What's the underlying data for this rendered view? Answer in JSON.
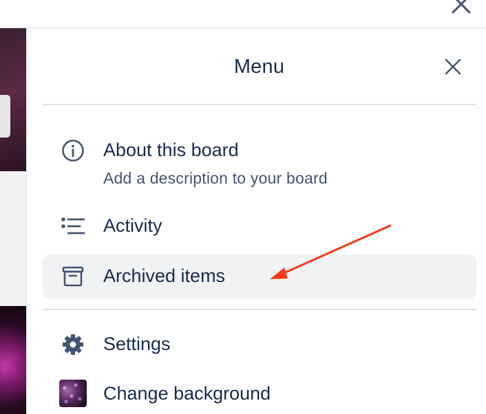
{
  "window": {
    "close_icon": "close-icon"
  },
  "menu": {
    "title": "Menu",
    "close_icon": "close-icon",
    "items": [
      {
        "label": "About this board",
        "description": "Add a description to your board",
        "icon": "info-icon"
      },
      {
        "label": "Activity",
        "icon": "activity-list-icon"
      },
      {
        "label": "Archived items",
        "icon": "archive-box-icon",
        "selected": true
      },
      {
        "label": "Settings",
        "icon": "gear-icon"
      },
      {
        "label": "Change background",
        "icon": "background-thumbnail"
      }
    ]
  },
  "annotation": {
    "type": "arrow",
    "color": "#f2391b",
    "points_to": "Archived items"
  },
  "colors": {
    "text": "#172b4d",
    "subtext": "#44546f",
    "selected_bg": "#f1f2f4",
    "divider": "#dfe1e6"
  }
}
